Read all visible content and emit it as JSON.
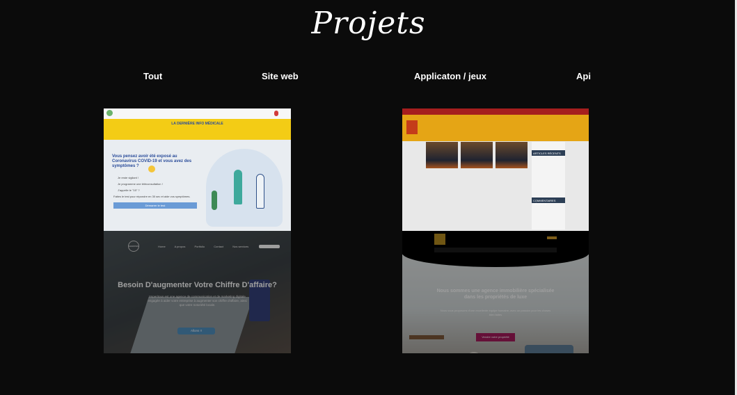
{
  "section": {
    "title": "Projets"
  },
  "filters": [
    {
      "label": "Tout"
    },
    {
      "label": "Site web"
    },
    {
      "label": "Applicaton / jeux"
    },
    {
      "label": "Api"
    }
  ],
  "projects": {
    "medical": {
      "band_title": "LA DERNIÈRE INFO MÉDICALE",
      "question": "Vous pensez avoir été exposé au Coronavirus COVID-19 et vous avez des symptômes ?",
      "lines": [
        "Je reste vigilant !",
        "Je programme une téléconsultation !",
        "J'appelle le \"15\" ?",
        "Faites le test pour répondre en 30 sec et aide vos symptômes."
      ],
      "button": "Démarrer le test"
    },
    "newspaper": {
      "sidebar_heading": "ARTICLES RÉCENTS",
      "sidebar_heading2": "COMMENTAIRES RÉCENTS"
    },
    "agency": {
      "logo": "MAROSIS",
      "menu": [
        "Home",
        "A propos",
        "Portfolio",
        "Contact",
        "Nos services"
      ],
      "heading": "Besoin D'augmenter Votre Chiffre D'affaire?",
      "subtitle": "Imperitous est une agence de communication et de marketing digitale engagée à aider votre entreprise à augmenter son chiffre d'affaire, ainsi que votre notoriété locale.",
      "cta": "Allons !!"
    },
    "realestate": {
      "heading": "Nous sommes une agence immobilière spécialisée dans les propriétés de luxe",
      "subtitle": "Nous vous proposons d'une excellente équipe humaine, avec un passion pour les choses bien faites",
      "cta": "Vendre votre propriété"
    }
  }
}
